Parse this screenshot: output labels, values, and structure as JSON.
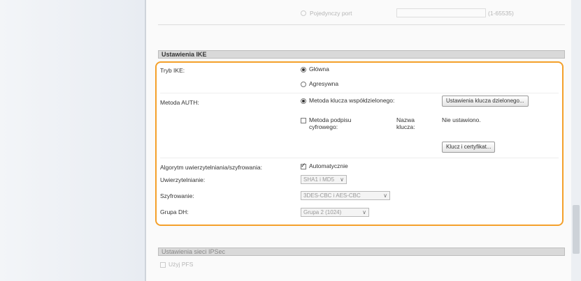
{
  "top": {
    "port_option_label": "Pojedynczy port",
    "port_range_hint": "(1-65535)"
  },
  "ike": {
    "header": "Ustawienia IKE",
    "mode": {
      "label": "Tryb IKE:",
      "options": [
        "Główna",
        "Agresywna"
      ],
      "selected": "Główna"
    },
    "auth": {
      "label": "Metoda AUTH:",
      "psk_option": "Metoda klucza współdzielonego:",
      "psk_button": "Ustawienia klucza dzielonego...",
      "cert_option_line1": "Metoda podpisu",
      "cert_option_line2": "cyfrowego:",
      "key_name_label_line1": "Nazwa",
      "key_name_label_line2": "klucza:",
      "key_name_value": "Nie ustawiono.",
      "cert_button": "Klucz i certyfikat..."
    },
    "algorithm": {
      "label": "Algorytm uwierzytelniania/szyfrowania:",
      "auto_label": "Automatycznie",
      "auto_checked": true
    },
    "authentication": {
      "label": "Uwierzytelnianie:",
      "value": "SHA1 i MD5"
    },
    "encryption": {
      "label": "Szyfrowanie:",
      "value": "3DES-CBC i AES-CBC"
    },
    "dh_group": {
      "label": "Grupa DH:",
      "value": "Grupa 2 (1024)"
    }
  },
  "ipsec": {
    "header": "Ustawienia sieci IPSec",
    "pfs_label": "Użyj PFS"
  },
  "colors": {
    "highlight": "#f4a02a",
    "header_bg": "#d9d9d9"
  }
}
